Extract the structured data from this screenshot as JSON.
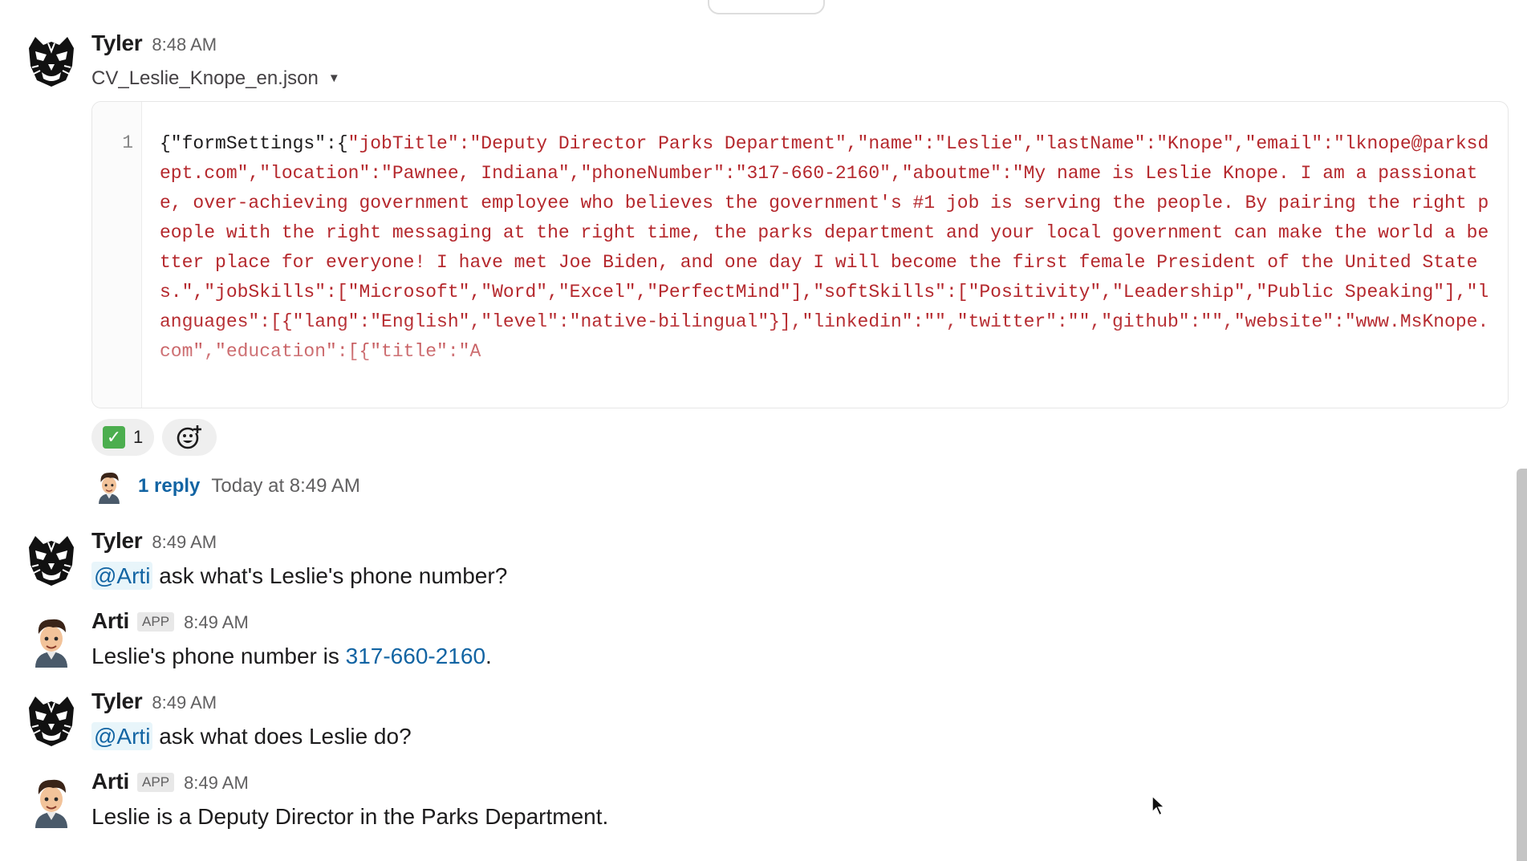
{
  "messages": [
    {
      "author": "Tyler",
      "time": "8:48 AM",
      "file": {
        "name": "CV_Leslie_Knope_en.json",
        "line_number": "1",
        "code_open": "{\"formSettings\":{",
        "code_body": "\"jobTitle\":\"Deputy Director Parks Department\",\"name\":\"Leslie\",\"lastName\":\"Knope\",\"email\":\"lknope@parksdept.com\",\"location\":\"Pawnee, Indiana\",\"phoneNumber\":\"317-660-2160\",\"aboutme\":\"My name is Leslie Knope. I am a passionate, over-achieving government employee who believes the government's #1 job is serving the people. By pairing the right people with the right messaging at the right time, the parks department and your local government can make the world a better place for everyone! I have met Joe Biden, and one day I will become the first female President of the United States.\",\"jobSkills\":[\"Microsoft\",\"Word\",\"Excel\",\"PerfectMind\"],\"softSkills\":[\"Positivity\",\"Leadership\",\"Public Speaking\"],\"languages\":[{\"lang\":\"English\",\"level\":\"native-bilingual\"}],\"linkedin\":\"\",\"twitter\":\"\",\"github\":\"\",\"website\":\"www.MsKnope.com\",\"education\":[{\"title\":\"A"
      },
      "reactions": [
        {
          "emoji": "✅",
          "count": "1"
        }
      ],
      "thread": {
        "reply_count": "1 reply",
        "last_reply": "Today at 8:49 AM"
      }
    },
    {
      "author": "Tyler",
      "time": "8:49 AM",
      "mention": "@Arti",
      "text": " ask what's Leslie's phone number?"
    },
    {
      "author": "Arti",
      "badge": "APP",
      "time": "8:49 AM",
      "text_before": "Leslie's phone number is ",
      "link": "317-660-2160",
      "text_after": "."
    },
    {
      "author": "Tyler",
      "time": "8:49 AM",
      "mention": "@Arti",
      "text": " ask what does Leslie do?"
    },
    {
      "author": "Arti",
      "badge": "APP",
      "time": "8:49 AM",
      "text": "Leslie is a Deputy Director in the Parks Department."
    }
  ],
  "icons": {
    "tyler_avatar": "tiger-face-icon",
    "arti_avatar": "cartoon-boy-icon",
    "dropdown": "caret-down-icon",
    "add_reaction": "add-emoji-icon",
    "cursor": "mouse-pointer-icon"
  },
  "colors": {
    "link": "#1264a3",
    "code_string": "#b5282d",
    "mention_bg": "#e8f5fa"
  }
}
